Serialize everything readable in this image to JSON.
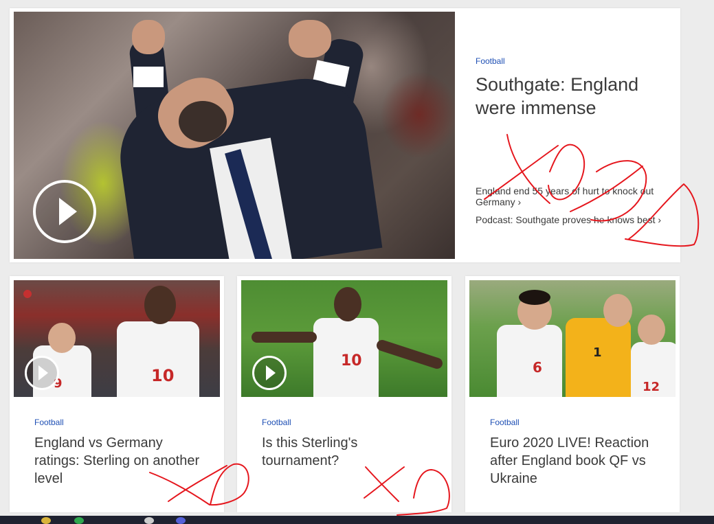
{
  "hero": {
    "category": "Football",
    "title": "Southgate: England were immense",
    "related": [
      {
        "label": "England end 55 years of hurt to knock out Germany",
        "chevron": "›"
      },
      {
        "label": "Podcast: Southgate proves he knows best",
        "chevron": "›"
      }
    ],
    "has_video": true
  },
  "cards": [
    {
      "category": "Football",
      "title": "England vs Germany ratings: Sterling on another level",
      "has_video": true,
      "shirt_numbers": [
        "9",
        "10"
      ]
    },
    {
      "category": "Football",
      "title": "Is this Sterling's tournament?",
      "has_video": true,
      "shirt_numbers": [
        "10"
      ]
    },
    {
      "category": "Football",
      "title": "Euro 2020 LIVE! Reaction after England book QF vs Ukraine",
      "has_video": false,
      "shirt_numbers": [
        "6",
        "1",
        "12"
      ]
    }
  ],
  "colors": {
    "category_blue": "#1e4fb4",
    "headline": "#3a3a3a",
    "annotation_red": "#e5161d",
    "page_bg": "#ececec"
  },
  "icons": [
    "play-icon",
    "chevron-right-icon"
  ]
}
